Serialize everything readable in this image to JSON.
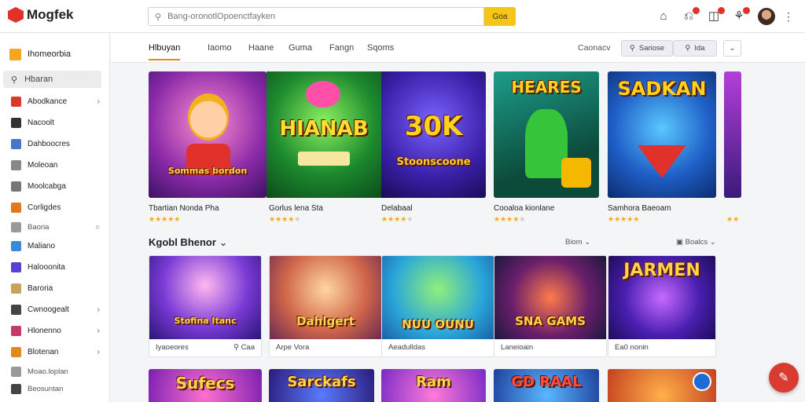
{
  "app": {
    "name": "Mogfek"
  },
  "search": {
    "placeholder": "Bang-oronotlOpoenctfayken",
    "button": "Goa"
  },
  "sidebar": {
    "header": "Ihomeorbia",
    "selected": "Hbaran",
    "items": [
      {
        "label": "Abodkance",
        "chevron": true,
        "color": "#d9382d"
      },
      {
        "label": "Nacoolt",
        "chevron": false,
        "color": "#333333"
      },
      {
        "label": "Dahboocres",
        "chevron": false,
        "color": "#4a76c9"
      },
      {
        "label": "Moleoan",
        "chevron": false,
        "color": "#888888"
      },
      {
        "label": "Moolcabga",
        "chevron": false,
        "color": "#777777"
      },
      {
        "label": "Corligdes",
        "chevron": false,
        "color": "#e0781f"
      },
      {
        "label": "Baoria",
        "chevron": false,
        "color": "#999999",
        "small": true,
        "dot": true
      },
      {
        "label": "Maliano",
        "chevron": false,
        "color": "#3a8bd6"
      },
      {
        "label": "Halooonita",
        "chevron": false,
        "color": "#5b3fd0"
      },
      {
        "label": "Baroria",
        "chevron": false,
        "color": "#c8a45a"
      },
      {
        "label": "Cwnoogealt",
        "chevron": true,
        "color": "#444444"
      },
      {
        "label": "Hlonenno",
        "chevron": true,
        "color": "#c23b6a"
      },
      {
        "label": "Blotenan",
        "chevron": true,
        "color": "#e08a1e"
      },
      {
        "label": "Moao.loplan",
        "chevron": false,
        "color": "#999999",
        "small": true
      },
      {
        "label": "Beosuntan",
        "chevron": false,
        "color": "#444444",
        "small": true
      }
    ]
  },
  "tabs": {
    "items": [
      "Hlbuyan",
      "Iaomo",
      "Haane",
      "Guma",
      "Fangn",
      "Sqoms"
    ],
    "active": 0,
    "right_label": "Caonacv",
    "btn1": "Sariose",
    "btn2": "Ida"
  },
  "featured": [
    {
      "title": "Tbartian Nonda Pha",
      "art": "Sommas bordon",
      "rating": 5
    },
    {
      "title": "Gorlus lena Sta",
      "art": "HIANAB",
      "rating": 4
    },
    {
      "title": "Delabaal",
      "art": "Stoonscoone",
      "rating": 4
    },
    {
      "title": "Cooaloa kionlane",
      "art": "HEARES",
      "rating": 4
    },
    {
      "title": "Samhora Baeoam",
      "art": "SADKAN",
      "rating": 5
    }
  ],
  "section": {
    "title": "Kgobl Bhenor",
    "sort": "Biom",
    "filter": "Boalcs"
  },
  "tiles": [
    {
      "art": "Stofina Itanc",
      "label": "Iyaoeores",
      "meta": "Caa"
    },
    {
      "art": "Dahlgert",
      "label": "Arpe Vora",
      "meta": ""
    },
    {
      "art": "NUU OUNU",
      "label": "Aeadulldas",
      "meta": ""
    },
    {
      "art": "SNA GAMS",
      "label": "Laneioain",
      "meta": ""
    },
    {
      "art": "JARMEN",
      "label": "Ea0 nonin",
      "meta": ""
    }
  ],
  "bottom_row": [
    "Sufecs",
    "Sarckafs",
    "Ram",
    "GD RAAL",
    ""
  ]
}
